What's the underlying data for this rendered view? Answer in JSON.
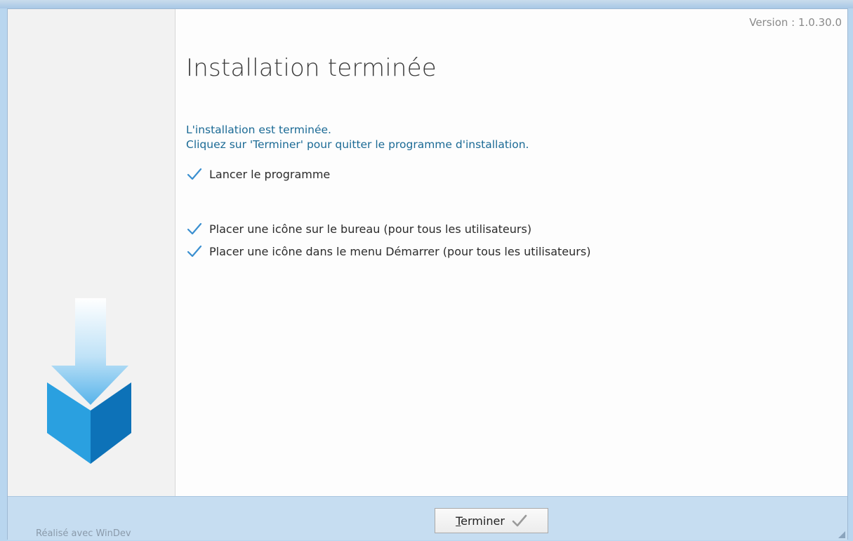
{
  "header": {
    "version": "Version : 1.0.30.0"
  },
  "main": {
    "title": "Installation terminée",
    "message_line1": "L'installation est terminée.",
    "message_line2": "Cliquez sur 'Terminer' pour quitter le programme d'installation."
  },
  "options": [
    {
      "label": "Lancer le programme",
      "checked": true
    },
    {
      "label": "Placer une icône sur le bureau (pour tous les utilisateurs)",
      "checked": true
    },
    {
      "label": "Placer une icône dans le menu Démarrer (pour tous les utilisateurs)",
      "checked": true
    }
  ],
  "footer": {
    "credit": "Réalisé avec WinDev",
    "finish_button_first": "T",
    "finish_button_rest": "erminer"
  },
  "colors": {
    "accent": "#1b6a95",
    "check": "#3a8fd0",
    "logo_light": "#2aa0e0",
    "logo_dark": "#0d72b8"
  },
  "icons": {
    "logo": "download-box-icon",
    "check": "checkmark-icon",
    "button_check": "gray-checkmark-icon"
  }
}
